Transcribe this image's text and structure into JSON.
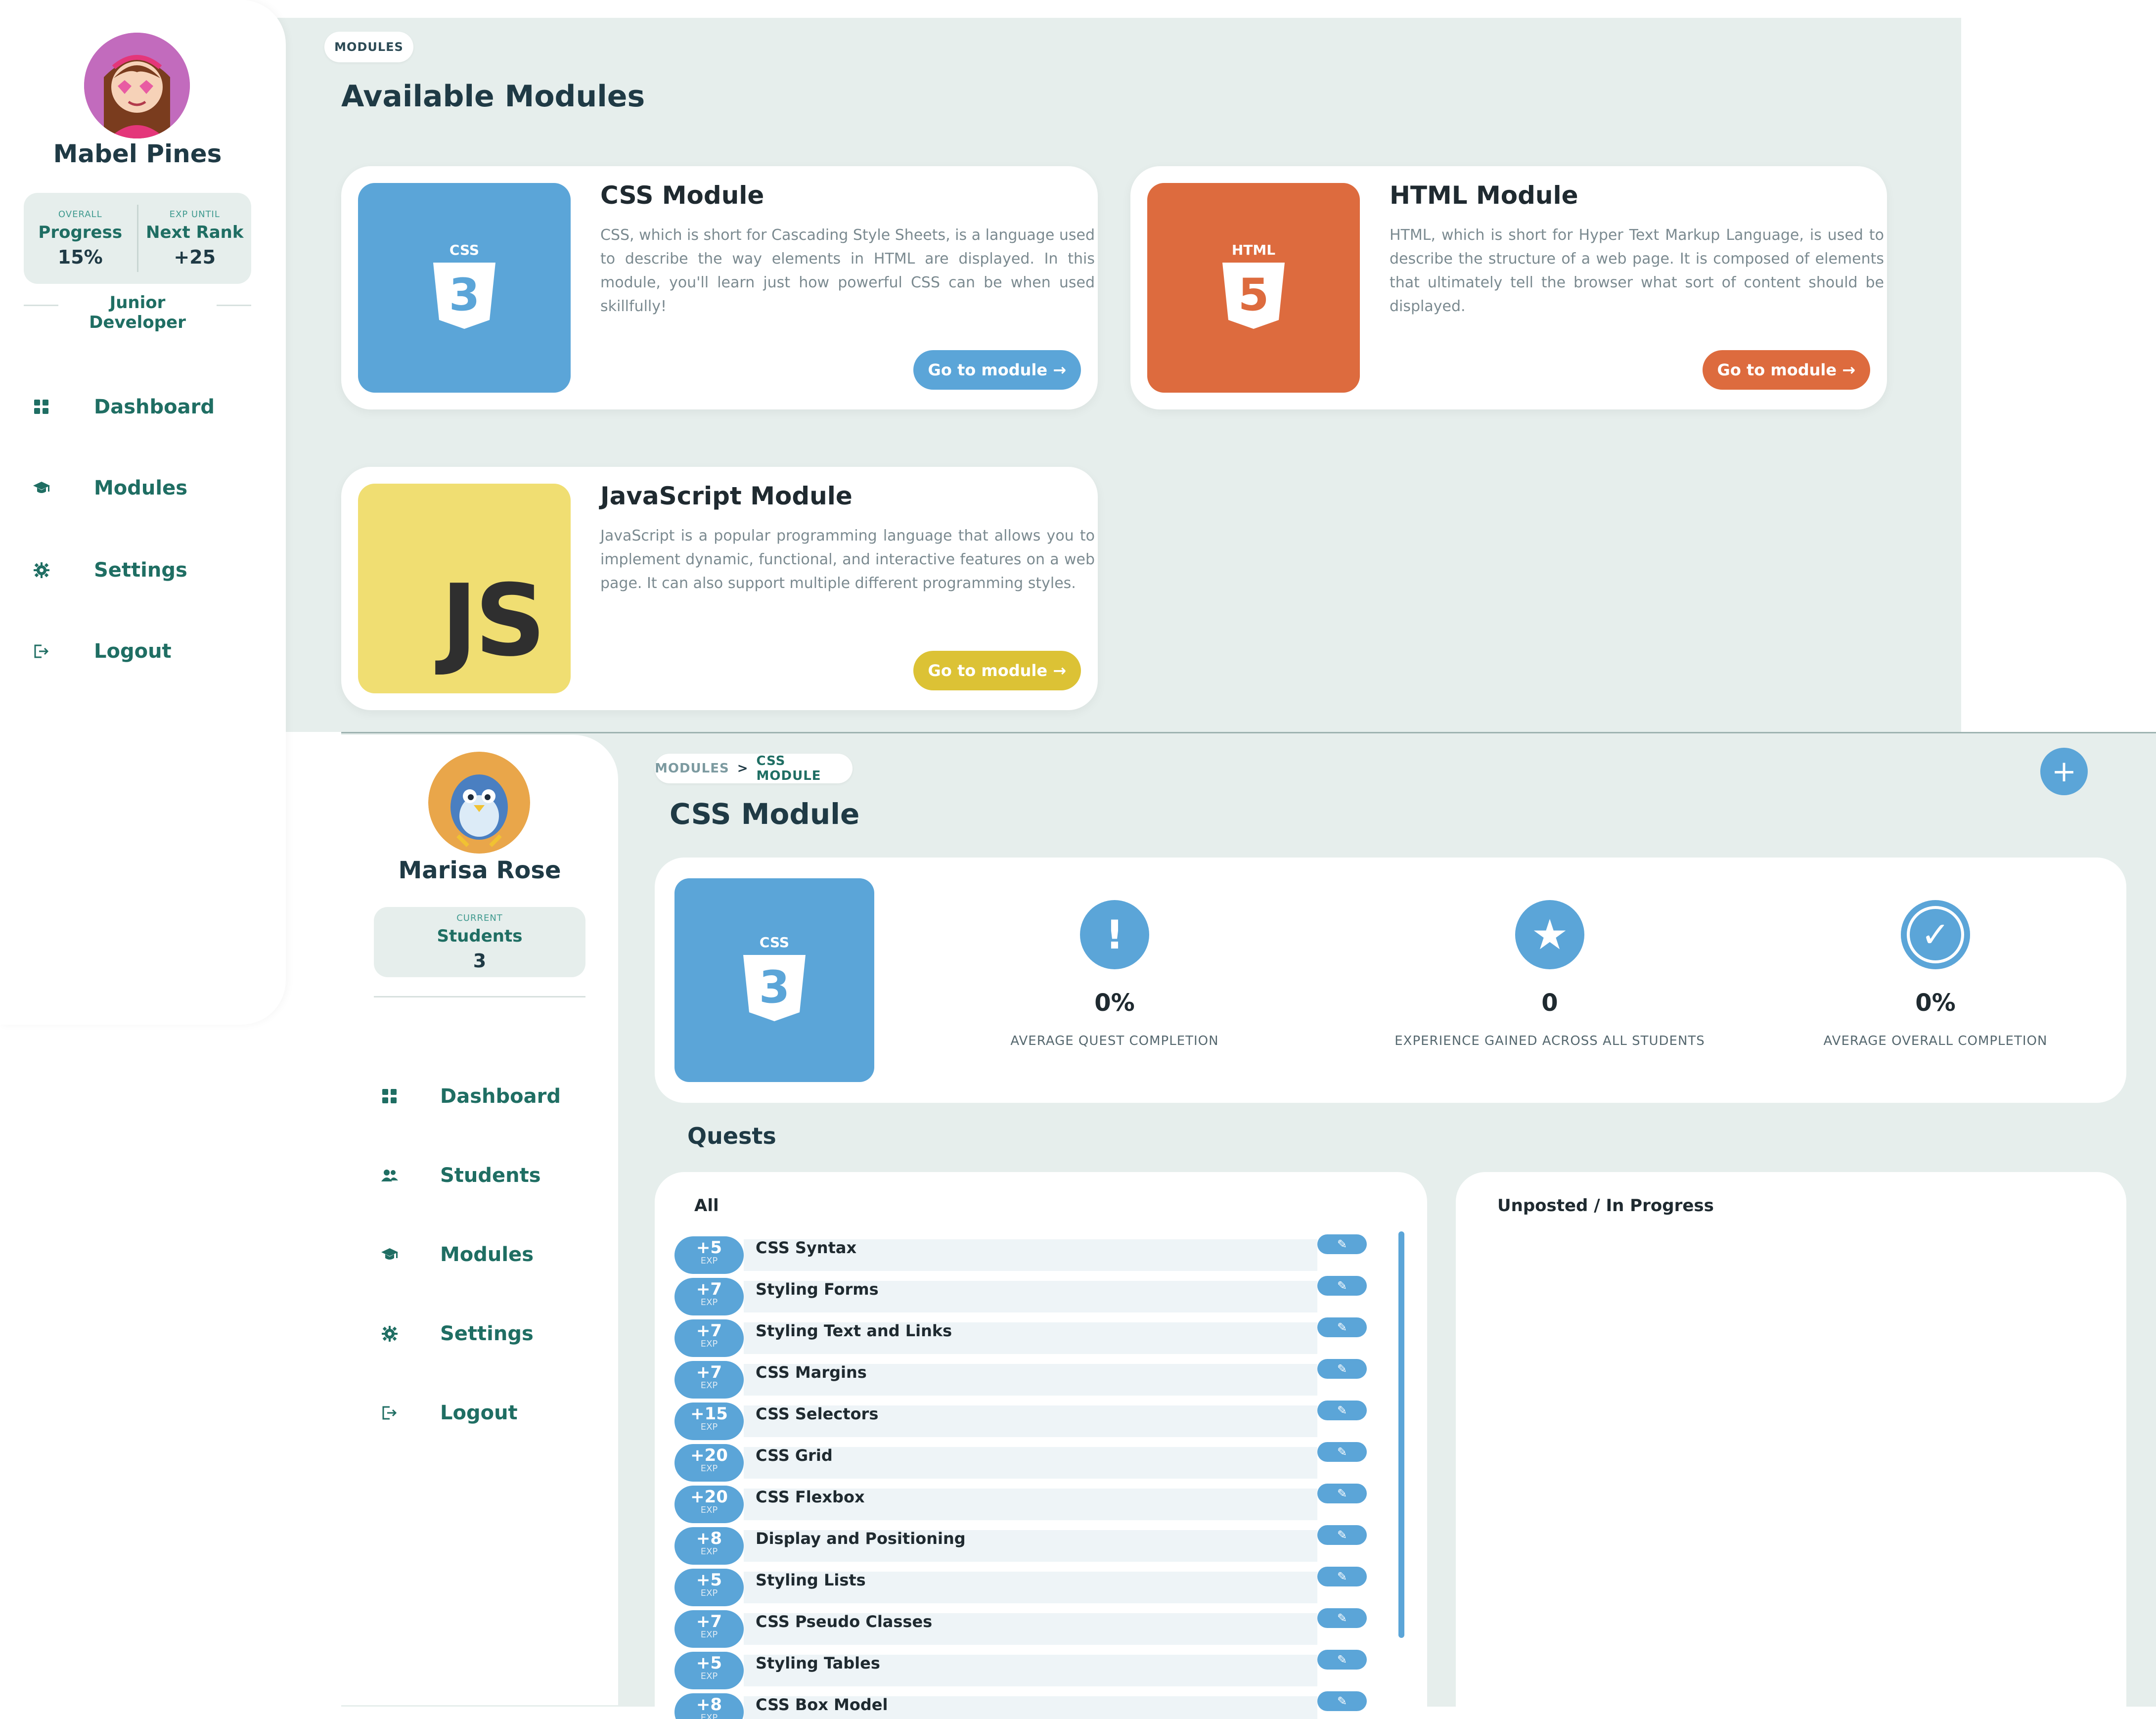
{
  "student_view": {
    "user": {
      "name": "Mabel Pines",
      "rank_title": "Junior Developer"
    },
    "stats": [
      {
        "caption": "OVERALL",
        "label": "Progress",
        "value": "15%"
      },
      {
        "caption": "EXP UNTIL",
        "label": "Next Rank",
        "value": "+25"
      }
    ],
    "nav": [
      {
        "label": "Dashboard",
        "icon": "dashboard-grid-icon"
      },
      {
        "label": "Modules",
        "icon": "graduation-cap-icon"
      },
      {
        "label": "Settings",
        "icon": "gear-icon"
      },
      {
        "label": "Logout",
        "icon": "logout-icon"
      }
    ],
    "breadcrumb": "MODULES",
    "title": "Available Modules",
    "modules": [
      {
        "name": "CSS Module",
        "badge": "CSS",
        "color": "#5ba5d8",
        "button": "Go to module →",
        "description": "CSS, which is short for Cascading Style Sheets, is a language used to describe the way elements in HTML are displayed. In this module, you'll learn just how powerful CSS can be when used skillfully!"
      },
      {
        "name": "HTML Module",
        "badge": "HTML",
        "color": "#dd6b3e",
        "button": "Go to module →",
        "description": "HTML, which is short for Hyper Text Markup Language, is used to describe the structure of a web page. It is composed of elements that ultimately tell the browser what sort of content should be displayed."
      },
      {
        "name": "JavaScript Module",
        "badge": "JS",
        "color": "#f0de72",
        "button_color": "#dcc235",
        "button": "Go to module →",
        "description": "JavaScript is a popular programming language that allows you to implement dynamic, functional, and interactive features on a web page. It can also support multiple different programming styles."
      }
    ]
  },
  "teacher_view": {
    "user": {
      "name": "Marisa Rose"
    },
    "stat": {
      "caption": "CURRENT",
      "label": "Students",
      "value": "3"
    },
    "nav": [
      {
        "label": "Dashboard",
        "icon": "dashboard-grid-icon"
      },
      {
        "label": "Students",
        "icon": "users-icon"
      },
      {
        "label": "Modules",
        "icon": "graduation-cap-icon"
      },
      {
        "label": "Settings",
        "icon": "gear-icon"
      },
      {
        "label": "Logout",
        "icon": "logout-icon"
      }
    ],
    "breadcrumb": {
      "parent": "MODULES",
      "separator": ">",
      "current": "CSS MODULE"
    },
    "title": "CSS Module",
    "add_button": "+",
    "module_badge": "CSS",
    "metrics": [
      {
        "icon": "exclamation-icon",
        "glyph": "!",
        "value": "0%",
        "caption": "AVERAGE QUEST COMPLETION"
      },
      {
        "icon": "star-icon",
        "glyph": "★",
        "value": "0",
        "caption": "EXPERIENCE GAINED ACROSS ALL STUDENTS"
      },
      {
        "icon": "check-circle-icon",
        "glyph": "✓",
        "value": "0%",
        "caption": "AVERAGE OVERALL COMPLETION"
      }
    ],
    "quests_heading": "Quests",
    "all_heading": "All",
    "unposted_heading": "Unposted / In Progress",
    "exp_label": "EXP",
    "edit_glyph": "✎",
    "quests": [
      {
        "exp": "+5",
        "name": "CSS Syntax"
      },
      {
        "exp": "+7",
        "name": "Styling Forms"
      },
      {
        "exp": "+7",
        "name": "Styling Text and Links"
      },
      {
        "exp": "+7",
        "name": "CSS Margins"
      },
      {
        "exp": "+15",
        "name": "CSS Selectors"
      },
      {
        "exp": "+20",
        "name": "CSS Grid"
      },
      {
        "exp": "+20",
        "name": "CSS Flexbox"
      },
      {
        "exp": "+8",
        "name": "Display and Positioning"
      },
      {
        "exp": "+5",
        "name": "Styling Lists"
      },
      {
        "exp": "+7",
        "name": "CSS Pseudo Classes"
      },
      {
        "exp": "+5",
        "name": "Styling Tables"
      },
      {
        "exp": "+8",
        "name": "CSS Box Model"
      }
    ]
  },
  "colors": {
    "teal": "#1f6e63",
    "bg": "#e6eeec",
    "blue": "#5ba5d8",
    "orange": "#dd6b3e",
    "yellow": "#f0de72"
  }
}
